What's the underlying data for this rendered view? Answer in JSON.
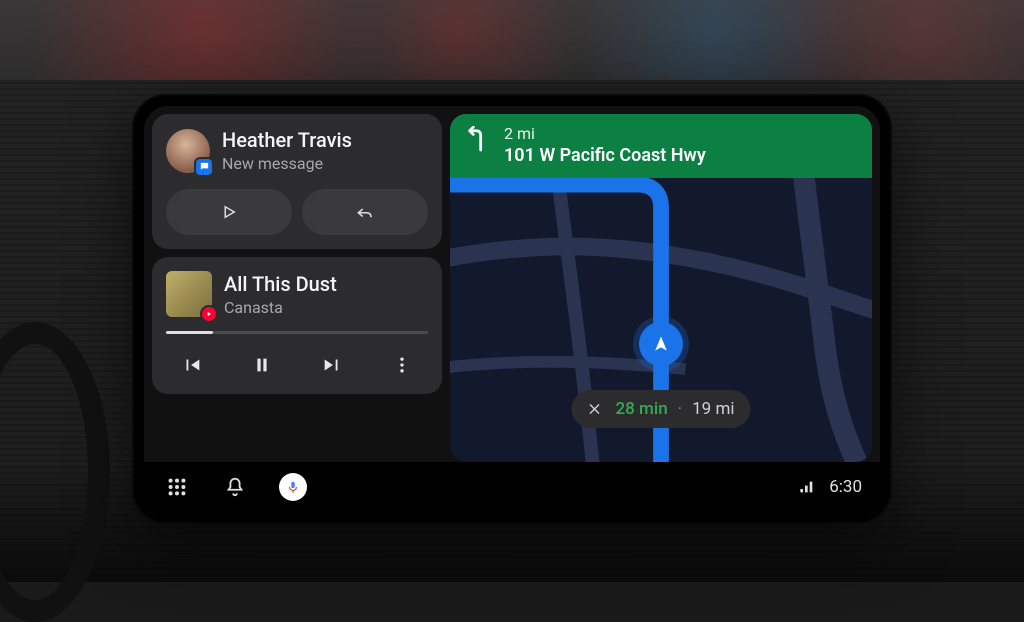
{
  "notification": {
    "sender": "Heather Travis",
    "subtitle": "New message",
    "app_icon": "messages-icon"
  },
  "media": {
    "title": "All This Dust",
    "artist": "Canasta",
    "app_icon": "youtube-music-icon",
    "progress_pct": 18
  },
  "navigation": {
    "maneuver_icon": "turn-left-icon",
    "distance": "2 mi",
    "destination": "101 W Pacific Coast Hwy",
    "eta_time": "28 min",
    "eta_distance": "19 mi"
  },
  "statusbar": {
    "time": "6:30"
  }
}
